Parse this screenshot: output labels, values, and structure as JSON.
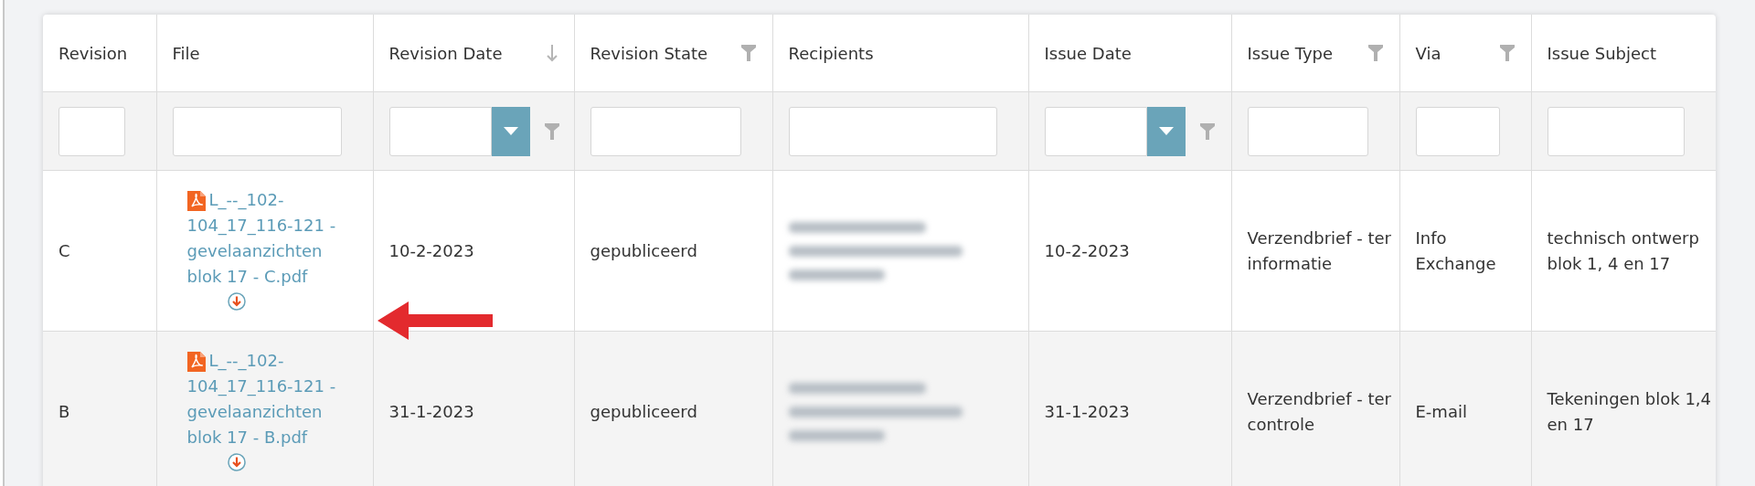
{
  "table": {
    "columns": [
      {
        "label": "Revision",
        "filter": {
          "kind": "text"
        }
      },
      {
        "label": "File",
        "filter": {
          "kind": "text"
        }
      },
      {
        "label": "Revision Date",
        "kind": "sort",
        "filter": {
          "kind": "date"
        }
      },
      {
        "label": "Revision State",
        "kind": "filter",
        "filter": {
          "kind": "text"
        }
      },
      {
        "label": "Recipients",
        "filter": {
          "kind": "text"
        }
      },
      {
        "label": "Issue Date",
        "filter": {
          "kind": "date"
        }
      },
      {
        "label": "Issue Type",
        "kind": "filter",
        "filter": {
          "kind": "text"
        }
      },
      {
        "label": "Via",
        "kind": "filter",
        "filter": {
          "kind": "text"
        }
      },
      {
        "label": "Issue Subject",
        "filter": {
          "kind": "text"
        }
      }
    ],
    "rows": [
      {
        "revision": "C",
        "file": "L_--_102-104_17_116-121 - gevelaanzichten blok 17 - C.pdf",
        "revision_date": "10-2-2023",
        "revision_state": "gepubliceerd",
        "issue_date": "10-2-2023",
        "issue_type": "Verzendbrief - ter informatie",
        "via": "Info Exchange",
        "issue_subject": "technisch ontwerp blok 1, 4 en 17"
      },
      {
        "revision": "B",
        "file": "L_--_102-104_17_116-121 - gevelaanzichten blok 17 - B.pdf",
        "revision_date": "31-1-2023",
        "revision_state": "gepubliceerd",
        "issue_date": "31-1-2023",
        "issue_type": "Verzendbrief - ter controle",
        "via": "E-mail",
        "issue_subject": "Tekeningen blok 1,4 en 17"
      }
    ]
  }
}
